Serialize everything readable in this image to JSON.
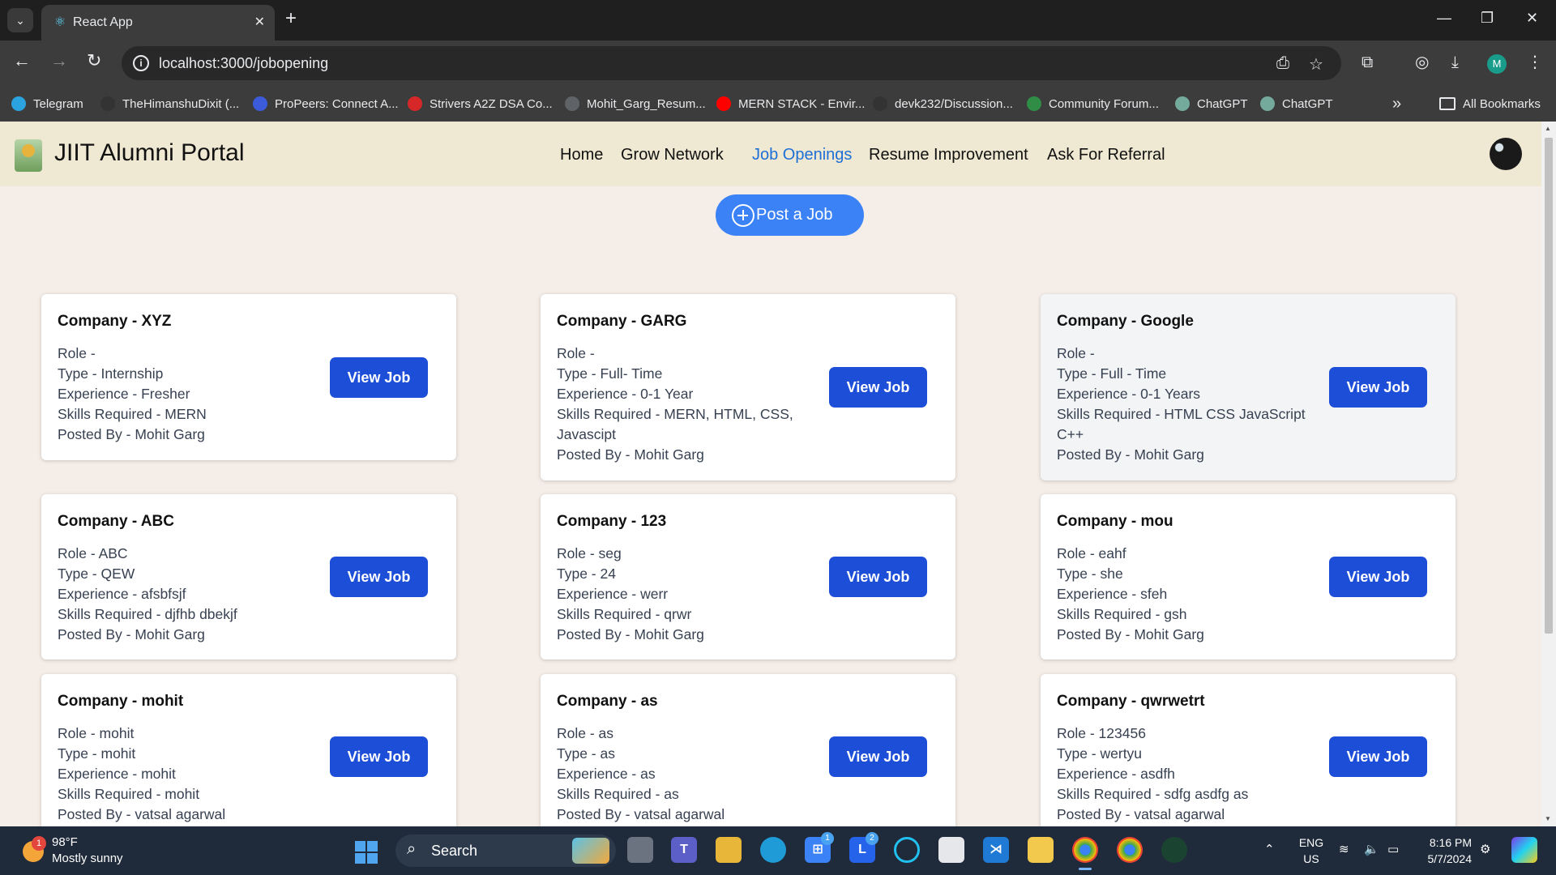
{
  "browser": {
    "tab_title": "React App",
    "url": "localhost:3000/jobopening",
    "profile_initial": "M",
    "bookmarks": [
      {
        "label": "Telegram",
        "icon": "telegram-icon",
        "color": "#2aa3df"
      },
      {
        "label": "TheHimanshuDixit (...",
        "icon": "github-icon",
        "color": "#333333"
      },
      {
        "label": "ProPeers: Connect A...",
        "icon": "propeers-icon",
        "color": "#3b5bdb"
      },
      {
        "label": "Strivers A2Z DSA Co...",
        "icon": "tuf-icon",
        "color": "#d62828"
      },
      {
        "label": "Mohit_Garg_Resum...",
        "icon": "globe-icon",
        "color": "#5f6368"
      },
      {
        "label": "MERN STACK - Envir...",
        "icon": "youtube-icon",
        "color": "#ff0000"
      },
      {
        "label": "devk232/Discussion...",
        "icon": "github-icon",
        "color": "#333333"
      },
      {
        "label": "Community Forum...",
        "icon": "gfg-icon",
        "color": "#2f8d46"
      },
      {
        "label": "ChatGPT",
        "icon": "chatgpt-icon",
        "color": "#74aa9c"
      },
      {
        "label": "ChatGPT",
        "icon": "chatgpt-icon",
        "color": "#74aa9c"
      }
    ],
    "all_bookmarks": "All Bookmarks",
    "overflow": "»"
  },
  "navbar": {
    "brand": "JIIT Alumni Portal",
    "links": [
      "Home",
      "Grow Network",
      "Job Openings",
      "Resume Improvement",
      "Ask For Referral"
    ],
    "active": "Job Openings"
  },
  "post_button": "Post a Job",
  "view_label": "View Job",
  "jobs": [
    {
      "company": "Company - XYZ",
      "lines": [
        "Role -",
        "Type - Internship",
        "Experience - Fresher",
        "Skills Required - MERN",
        "Posted By - Mohit Garg"
      ]
    },
    {
      "company": "Company - GARG",
      "lines": [
        "Role -",
        "Type - Full- Time",
        "Experience - 0-1 Year",
        "Skills Required - MERN, HTML, CSS, Javascipt",
        "Posted By - Mohit Garg"
      ]
    },
    {
      "company": "Company - Google",
      "lines": [
        "Role -",
        "Type - Full - Time",
        "Experience - 0-1 Years",
        "Skills Required - HTML CSS JavaScript C++",
        "Posted By - Mohit Garg"
      ]
    },
    {
      "company": "Company - ABC",
      "lines": [
        "Role - ABC",
        "Type - QEW",
        "Experience - afsbfsjf",
        "Skills Required - djfhb dbekjf",
        "Posted By - Mohit Garg"
      ]
    },
    {
      "company": "Company - 123",
      "lines": [
        "Role - seg",
        "Type - 24",
        "Experience - werr",
        "Skills Required - qrwr",
        "Posted By - Mohit Garg"
      ]
    },
    {
      "company": "Company - mou",
      "lines": [
        "Role - eahf",
        "Type - she",
        "Experience - sfeh",
        "Skills Required - gsh",
        "Posted By - Mohit Garg"
      ]
    },
    {
      "company": "Company - mohit",
      "lines": [
        "Role - mohit",
        "Type - mohit",
        "Experience - mohit",
        "Skills Required - mohit",
        "Posted By - vatsal agarwal"
      ]
    },
    {
      "company": "Company - as",
      "lines": [
        "Role - as",
        "Type - as",
        "Experience - as",
        "Skills Required - as",
        "Posted By - vatsal agarwal"
      ]
    },
    {
      "company": "Company - qwrwetrt",
      "lines": [
        "Role - 123456",
        "Type - wertyu",
        "Experience - asdfh",
        "Skills Required - sdfg asdfg as",
        "Posted By - vatsal agarwal"
      ]
    }
  ],
  "taskbar": {
    "weather_temp": "98°F",
    "weather_desc": "Mostly sunny",
    "weather_badge": "1",
    "search_label": "Search",
    "lang_top": "ENG",
    "lang_bottom": "US",
    "time": "8:16 PM",
    "date": "5/7/2024",
    "store_badge": "1",
    "lite_badge": "2"
  }
}
